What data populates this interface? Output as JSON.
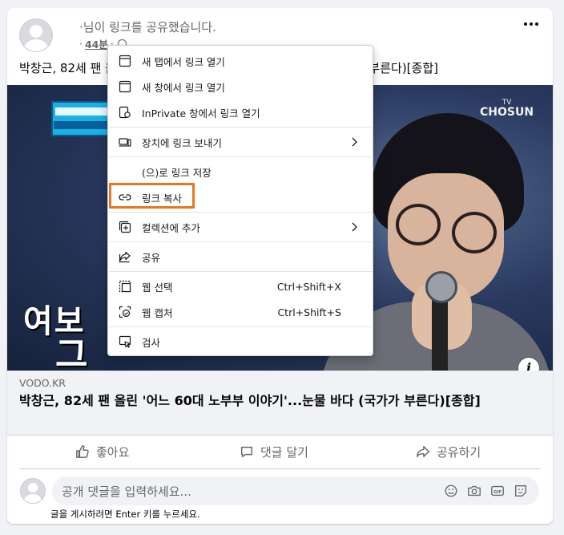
{
  "post": {
    "author_text": "·님이 링크를 공유했습니다.",
    "time": "44분",
    "time_prefix": "·",
    "text": "박창근, 82세 팬 올린 '어느 60대 노부부 이야기'...눈물 바다 (국가가 부른다)[종합]"
  },
  "media": {
    "channel": "CHOSUN",
    "channel_small": "TV",
    "caption1": "여보",
    "caption2": "그"
  },
  "link": {
    "domain": "VODO.KR",
    "title": "박창근, 82세 팬 올린 '어느 60대 노부부 이야기'...눈물 바다 (국가가 부른다)[종합]"
  },
  "actions": {
    "like": "좋아요",
    "comment": "댓글 달기",
    "share": "공유하기"
  },
  "comment": {
    "placeholder": "공개 댓글을 입력하세요...",
    "hint": "글을 게시하려면 Enter 키를 누르세요."
  },
  "menu": {
    "items": [
      {
        "label": "새 탭에서 링크 열기",
        "icon": "new-tab-icon"
      },
      {
        "label": "새 창에서 링크 열기",
        "icon": "new-window-icon"
      },
      {
        "label": "InPrivate 창에서 링크 열기",
        "icon": "inprivate-icon"
      },
      {
        "label": "장치에 링크 보내기",
        "icon": "send-device-icon"
      },
      {
        "label": "(으)로 링크 저장",
        "icon": ""
      },
      {
        "label": "링크 복사",
        "icon": "link-icon"
      },
      {
        "label": "컬렉션에 추가",
        "icon": "collections-icon"
      },
      {
        "label": "공유",
        "icon": "share-icon"
      },
      {
        "label": "웹 선택",
        "icon": "web-select-icon",
        "shortcut": "Ctrl+Shift+X"
      },
      {
        "label": "웹 캡처",
        "icon": "web-capture-icon",
        "shortcut": "Ctrl+Shift+S"
      },
      {
        "label": "검사",
        "icon": "inspect-icon"
      }
    ]
  },
  "colors": {
    "highlight": "#e8771e",
    "page_bg": "#f0f2f5",
    "secondary_text": "#65676b"
  }
}
